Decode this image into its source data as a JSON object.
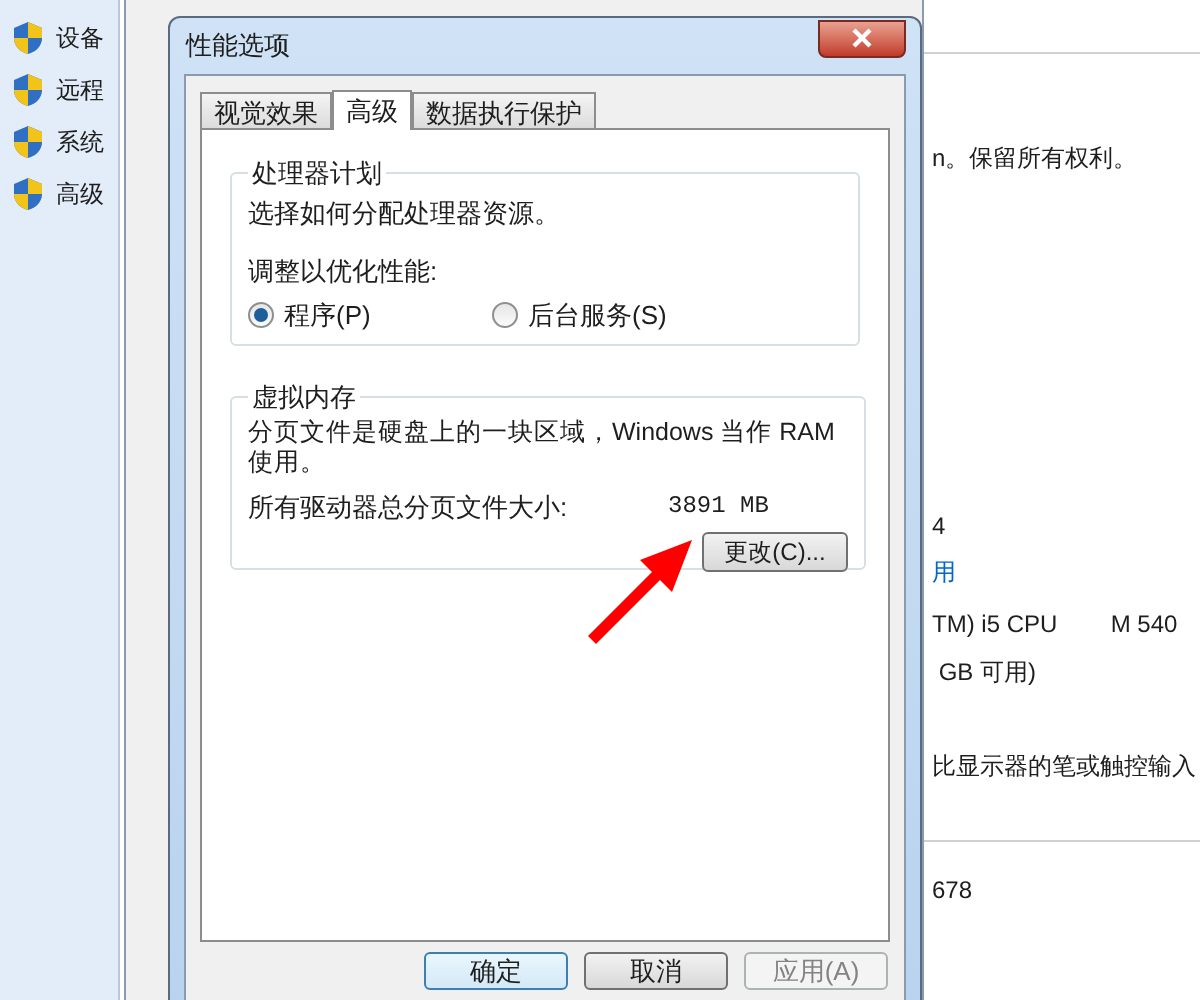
{
  "sidebar": {
    "items": [
      {
        "label": "设备"
      },
      {
        "label": "远程"
      },
      {
        "label": "系统"
      },
      {
        "label": "高级"
      }
    ]
  },
  "background_window": {
    "lines": [
      {
        "kind": "text",
        "text": "n。保留所有权利。"
      },
      {
        "kind": "text",
        "text": "4"
      },
      {
        "kind": "link",
        "text": "用"
      },
      {
        "kind": "text",
        "text": "TM) i5 CPU        M 540"
      },
      {
        "kind": "text",
        "text": " GB 可用)"
      },
      {
        "kind": "text",
        "text": "比显示器的笔或触控输入"
      },
      {
        "kind": "text",
        "text": "678"
      }
    ]
  },
  "dialog": {
    "title": "性能选项",
    "tabs": [
      {
        "label": "视觉效果",
        "selected": false
      },
      {
        "label": "高级",
        "selected": true
      },
      {
        "label": "数据执行保护",
        "selected": false
      }
    ],
    "processor_group": {
      "title": "处理器计划",
      "description": "选择如何分配处理器资源。",
      "adjust_label": "调整以优化性能:",
      "options": [
        {
          "label": "程序(P)",
          "selected": true
        },
        {
          "label": "后台服务(S)",
          "selected": false
        }
      ]
    },
    "memory_group": {
      "title": "虚拟内存",
      "description": "分页文件是硬盘上的一块区域，Windows 当作 RAM 使用。",
      "size_label": "所有驱动器总分页文件大小:",
      "size_value": "3891 MB",
      "change_button": "更改(C)..."
    },
    "buttons": [
      {
        "label": "确定",
        "disabled": false,
        "default": true
      },
      {
        "label": "取消",
        "disabled": false,
        "default": false
      },
      {
        "label": "应用(A)",
        "disabled": true,
        "default": false
      }
    ]
  }
}
